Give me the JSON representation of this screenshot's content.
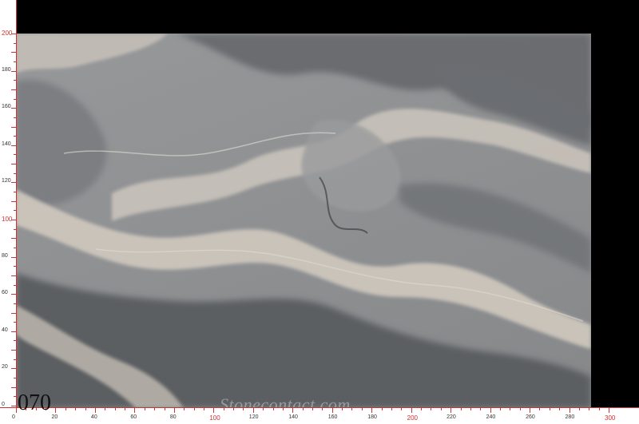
{
  "slab": {
    "id_text": "070",
    "watermark": "Stonecontact.com"
  },
  "ruler": {
    "vertical_labels": [
      "0",
      "20",
      "40",
      "60",
      "80",
      "100",
      "120",
      "140",
      "160",
      "180",
      "200"
    ],
    "horizontal_labels": [
      "0",
      "20",
      "40",
      "60",
      "80",
      "100",
      "120",
      "140",
      "160",
      "180",
      "200",
      "220",
      "240",
      "260",
      "280",
      "300"
    ],
    "major_labels": [
      "100",
      "200",
      "300"
    ],
    "color": "#cc3333"
  },
  "colors": {
    "background_black": "#000000",
    "marble_base": "#8d8f91",
    "marble_light_vein": "#c9c3bb",
    "marble_dark_vein": "#5c5e62"
  }
}
